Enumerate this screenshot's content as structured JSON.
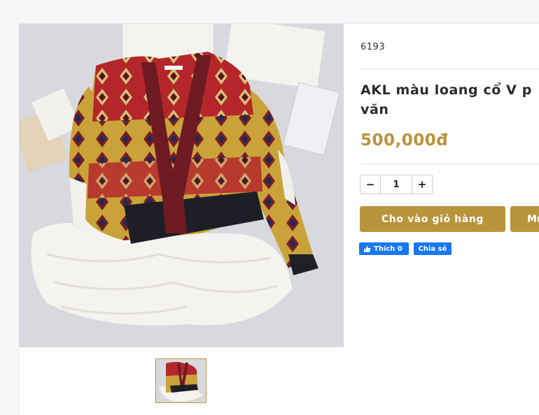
{
  "product": {
    "sku": "6193",
    "title": "AKL màu loang cổ V p văn",
    "title_line1": "AKL màu loang cổ V p",
    "title_line2": "văn",
    "price": "500,000đ",
    "quantity": "1",
    "main_image_icon": "product-photo",
    "thumbnail_icon": "product-thumbnail"
  },
  "quantity_control": {
    "minus_label": "−",
    "plus_label": "+"
  },
  "actions": {
    "add_to_cart_label": "Cho vào giỏ hàng",
    "buy_now_label": "Mu"
  },
  "social": {
    "like_label": "Thích 0",
    "share_label": "Chia sẻ"
  },
  "colors": {
    "accent": "#b8943b",
    "facebook": "#1877f2"
  }
}
